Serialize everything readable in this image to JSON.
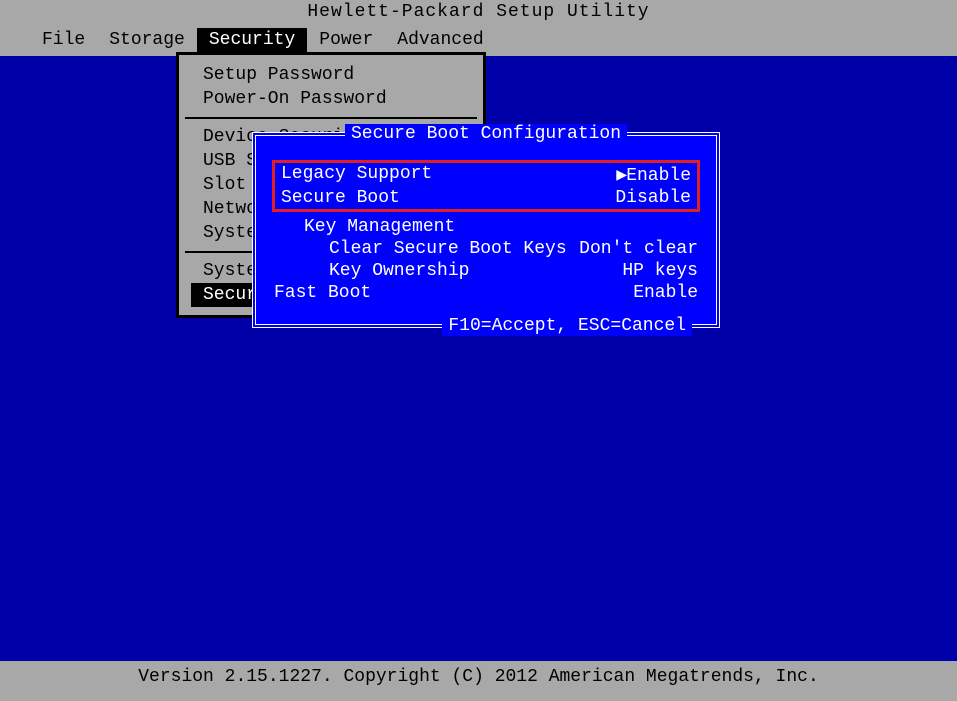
{
  "title": "Hewlett-Packard Setup Utility",
  "menu": {
    "items": [
      "File",
      "Storage",
      "Security",
      "Power",
      "Advanced"
    ],
    "selected_index": 2
  },
  "dropdown": {
    "group1": [
      "Setup Password",
      "Power-On Password"
    ],
    "group2": [
      "Device Security",
      "USB Security",
      "Slot Security",
      "Network Boot",
      "System IDs"
    ],
    "group3": [
      "System Security",
      "Secure Boot Configuration"
    ],
    "highlight_index": 1
  },
  "dialog": {
    "title": " Secure Boot Configuration ",
    "rows_highlight": [
      {
        "label": "Legacy Support",
        "value": "Enable",
        "arrow": "▶"
      },
      {
        "label": "Secure Boot",
        "value": "Disable",
        "arrow": ""
      }
    ],
    "rows": [
      {
        "label": "Key Management",
        "value": "",
        "indent": 1
      },
      {
        "label": "Clear Secure Boot Keys",
        "value": "Don't clear",
        "indent": 2
      },
      {
        "label": "Key Ownership",
        "value": "HP keys",
        "indent": 2
      },
      {
        "label": "Fast Boot",
        "value": "Enable",
        "indent": 0
      }
    ],
    "footer": " F10=Accept, ESC=Cancel "
  },
  "status": "Version 2.15.1227. Copyright (C) 2012 American Megatrends, Inc."
}
